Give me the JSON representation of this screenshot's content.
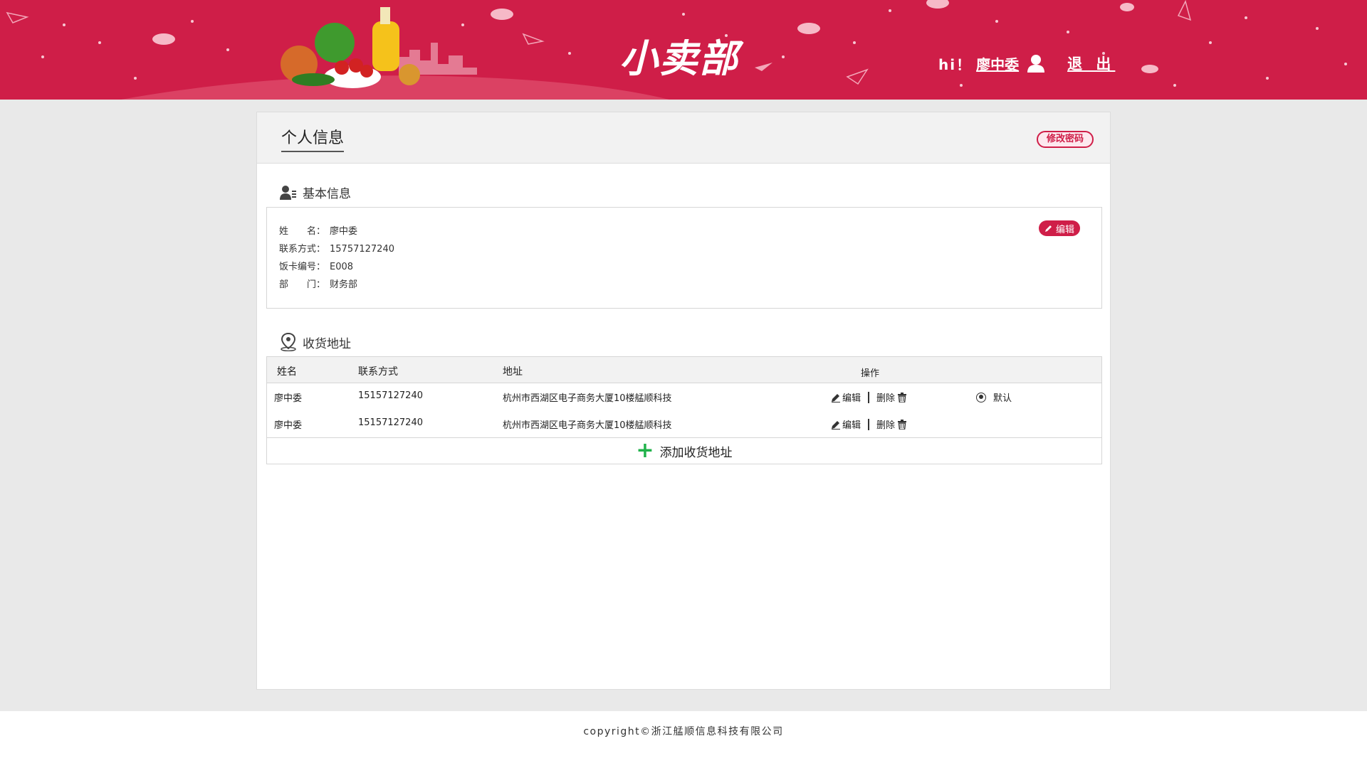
{
  "header": {
    "logo_text": "小卖部",
    "greeting": "hi！",
    "username": "廖中委",
    "logout_label": "退 出"
  },
  "page": {
    "title": "个人信息",
    "change_password_label": "修改密码"
  },
  "basic_info": {
    "section_title": "基本信息",
    "edit_label": "编辑",
    "fields": [
      {
        "label": "姓　　名：",
        "value": "廖中委"
      },
      {
        "label": "联系方式：",
        "value": "15757127240"
      },
      {
        "label": "饭卡编号：",
        "value": "E008"
      },
      {
        "label": "部　　门：",
        "value": "财务部"
      }
    ]
  },
  "address": {
    "section_title": "收货地址",
    "columns": [
      "姓名",
      "联系方式",
      "地址",
      "操作"
    ],
    "rows": [
      {
        "name": "廖中委",
        "phone": "15157127240",
        "address": "杭州市西湖区电子商务大厦10楼艋顺科技",
        "edit": "编辑",
        "delete": "删除",
        "default_label": "默认",
        "is_default": true
      },
      {
        "name": "廖中委",
        "phone": "15157127240",
        "address": "杭州市西湖区电子商务大厦10楼艋顺科技",
        "edit": "编辑",
        "delete": "删除",
        "default_label": "",
        "is_default": false
      }
    ],
    "add_label": "添加收货地址"
  },
  "footer": {
    "copyright": "copyright©浙江艋顺信息科技有限公司"
  },
  "colors": {
    "brand": "#cf1e48",
    "add": "#21b24b"
  }
}
